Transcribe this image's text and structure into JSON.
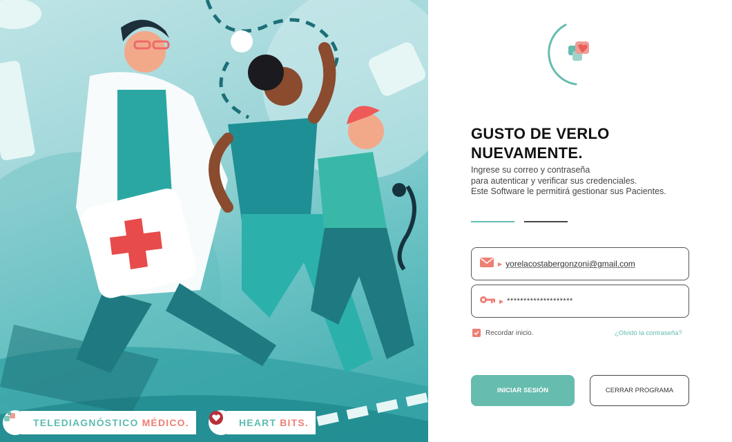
{
  "illustration": {
    "description_icon": "medical-team-running-illustration"
  },
  "brands": [
    {
      "icon": "medical-cross-icon",
      "name": "TELEDIAGNÓSTICO",
      "accent": "MÉDICO."
    },
    {
      "icon": "heart-icon",
      "name": "HEART",
      "accent": "BITS."
    }
  ],
  "login": {
    "logo_icon": "medical-logo-icon",
    "headline_line1": "GUSTO DE VERLO",
    "headline_line2": "NUEVAMENTE.",
    "subtitle_line1": "Ingrese su correo y contraseña",
    "subtitle_line2": "para autenticar y verificar sus credenciales.",
    "subtitle_line3": "Este Software le permitirá gestionar sus Pacientes.",
    "email_icon": "mail-icon",
    "email_value": "yorelacostabergonzoni@gmail.com",
    "password_icon": "key-icon",
    "password_value": "********************",
    "remember_label": "Recordar inicio.",
    "remember_checked": true,
    "forgot_label": "¿Olvidó la contraseña?",
    "login_button": "INICIAR SESIÓN",
    "close_button": "CERRAR PROGRAMA"
  },
  "colors": {
    "teal": "#66bcae",
    "coral": "#ee7f74",
    "dark": "#111111"
  }
}
